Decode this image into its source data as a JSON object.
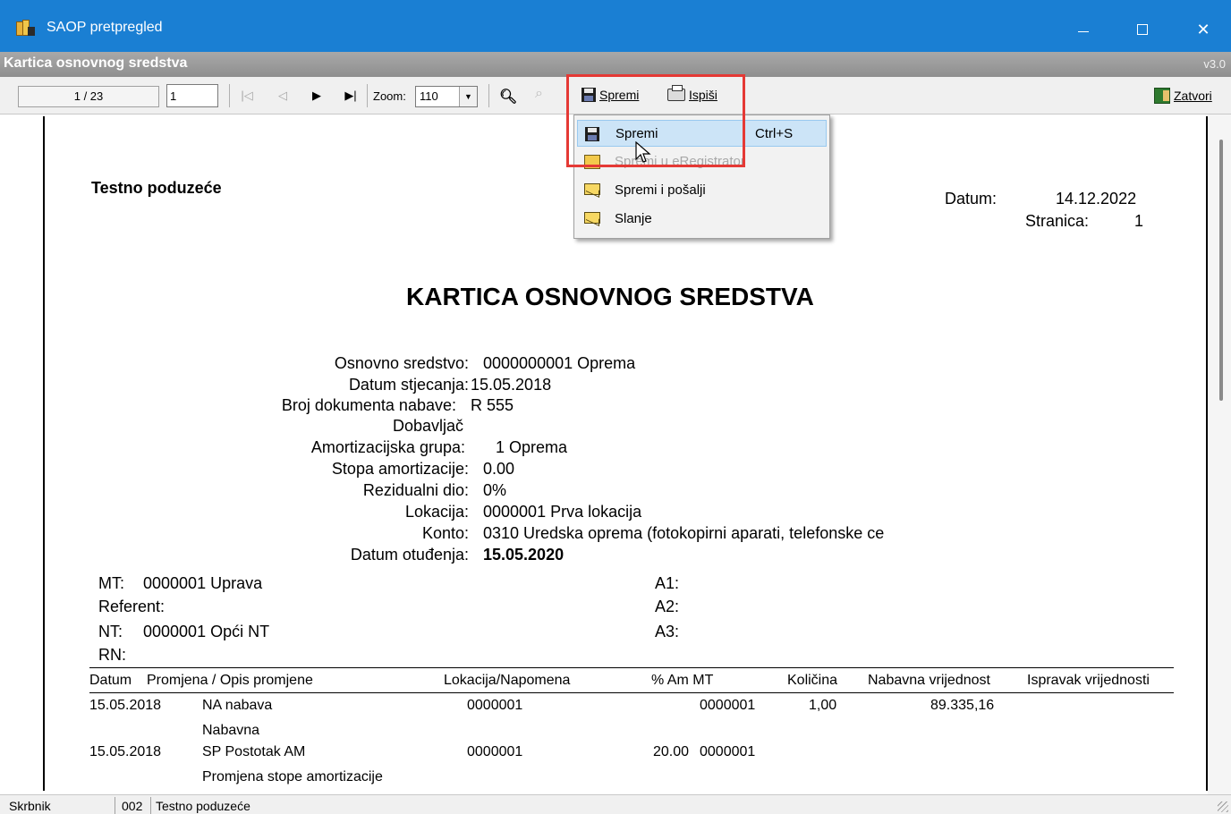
{
  "window": {
    "title": "SAOP pretpregled",
    "minimize_icon": "minimize-icon",
    "maximize_icon": "maximize-icon",
    "close_icon": "close-icon"
  },
  "subtitle": {
    "caption": "Kartica osnovnog sredstva",
    "version": "v3.0"
  },
  "toolbar": {
    "page_indicator": "1 / 23",
    "page_input": "1",
    "zoom_label": "Zoom:",
    "zoom_value": "110",
    "save_label": "Spremi",
    "save_icon": "floppy-disk-icon",
    "print_label": "Ispiši",
    "print_icon": "printer-icon",
    "close_label": "Zatvori",
    "close_icon": "exit-door-icon",
    "find_icon": "binoculars-icon",
    "find_next_icon": "find-next-icon",
    "nav_icons": [
      "first-page-icon",
      "previous-page-icon",
      "next-page-icon",
      "last-page-icon"
    ]
  },
  "menu": {
    "items": [
      {
        "label": "Spremi",
        "shortcut": "Ctrl+S",
        "icon": "floppy-disk-icon",
        "state": "selected"
      },
      {
        "label": "Spremi u eRegistrator",
        "shortcut": "",
        "icon": "registrator-icon",
        "state": "disabled"
      },
      {
        "label": "Spremi i pošalji",
        "shortcut": "",
        "icon": "envelope-icon",
        "state": "enabled"
      },
      {
        "label": "Slanje",
        "shortcut": "",
        "icon": "envelope-icon",
        "state": "enabled"
      }
    ]
  },
  "document": {
    "company": "Testno poduzeće",
    "datum_label": "Datum:",
    "datum_value": "14.12.2022",
    "stranica_label": "Stranica:",
    "stranica_value": "1",
    "title": "KARTICA OSNOVNOG SREDSTVA",
    "fields": [
      {
        "label": "Osnovno sredstvo:",
        "value": "0000000001 Oprema"
      },
      {
        "label": "Datum stjecanja:",
        "value": "15.05.2018"
      },
      {
        "label": "Broj dokumenta nabave:",
        "value": "R 555"
      },
      {
        "label": "Dobavljač",
        "value": ""
      },
      {
        "label": "Amortizacijska grupa:",
        "value": "1 Oprema"
      },
      {
        "label": "Stopa amortizacije:",
        "value": "0.00"
      },
      {
        "label": "Rezidualni dio:",
        "value": "0%"
      },
      {
        "label": "Lokacija:",
        "value": "0000001 Prva lokacija"
      },
      {
        "label": "Konto:",
        "value": "0310 Uredska oprema (fotokopirni aparati, telefonske ce"
      },
      {
        "label": "Datum otuđenja:",
        "value": "15.05.2020"
      }
    ],
    "meta_left": [
      {
        "label": "MT:",
        "value": "0000001 Uprava"
      },
      {
        "label": "Referent:",
        "value": ""
      },
      {
        "label": "NT:",
        "value": "0000001 Opći NT"
      },
      {
        "label": "RN:",
        "value": ""
      }
    ],
    "meta_right": [
      "A1:",
      "A2:",
      "A3:"
    ],
    "table": {
      "headers": [
        "Datum",
        "Promjena / Opis promjene",
        "Lokacija/Napomena",
        "% Am MT",
        "Količina",
        "Nabavna vrijednost",
        "Ispravak vrijednosti"
      ],
      "rows": [
        {
          "datum": "15.05.2018",
          "opis": "NA nabava",
          "lokacija": "0000001",
          "am": "",
          "mt": "0000001",
          "kolicina": "1,00",
          "nabavna": "89.335,16",
          "ispravak": "",
          "note": "Nabavna"
        },
        {
          "datum": "15.05.2018",
          "opis": "SP Postotak AM",
          "lokacija": "0000001",
          "am": "20.00",
          "mt": "0000001",
          "kolicina": "",
          "nabavna": "",
          "ispravak": "",
          "note": "Promjena stope amortizacije"
        }
      ]
    }
  },
  "statusbar": {
    "user": "Skrbnik",
    "company_code": "002",
    "company_name": "Testno poduzeće"
  },
  "colors": {
    "titlebar": "#1a7fd3",
    "highlight": "#e53935",
    "menu_selected": "#cce4f7"
  }
}
